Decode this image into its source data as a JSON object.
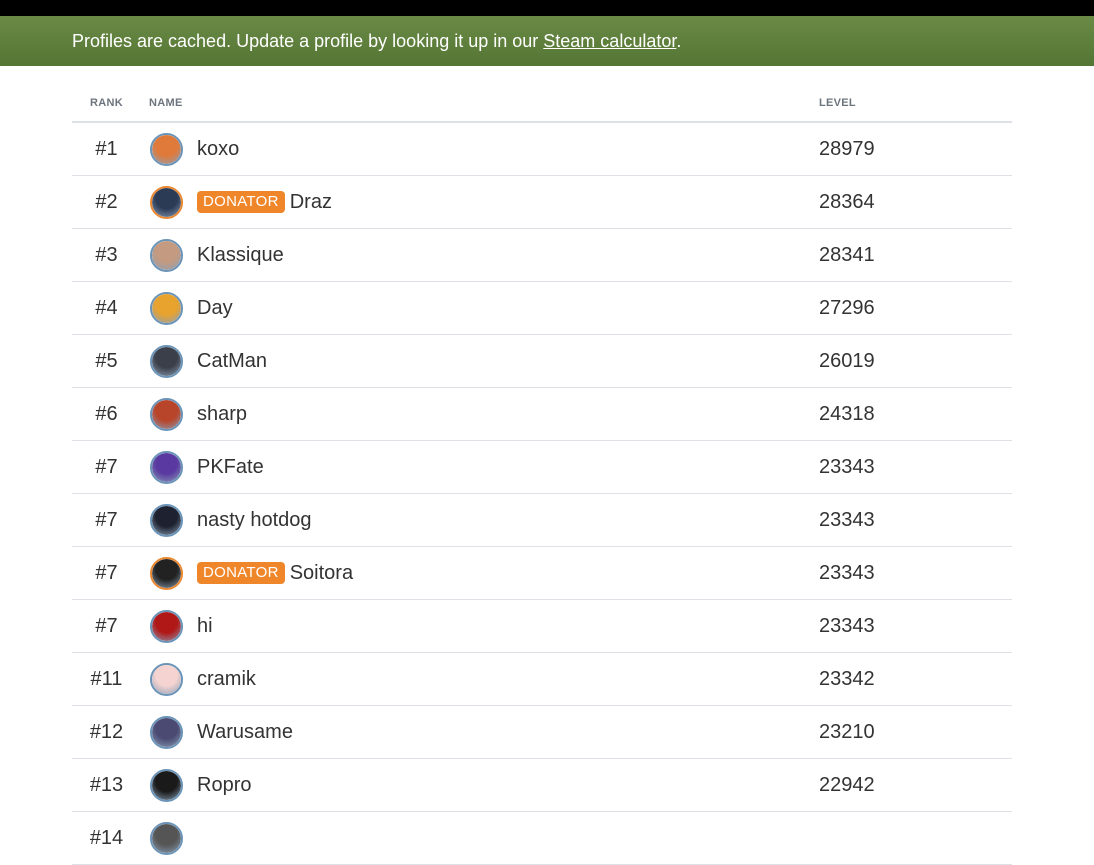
{
  "banner": {
    "text_before": "Profiles are cached. Update a profile by looking it up in our ",
    "link_label": "Steam calculator",
    "text_after": "."
  },
  "table": {
    "headers": {
      "rank": "RANK",
      "name": "NAME",
      "level": "LEVEL"
    },
    "rows": [
      {
        "rank": "#1",
        "name": "koxo",
        "level": "28979",
        "badge": "",
        "avatar_color": "#e07a3a"
      },
      {
        "rank": "#2",
        "name": "Draz",
        "level": "28364",
        "badge": "DONATOR",
        "avatar_color": "#2b3a55"
      },
      {
        "rank": "#3",
        "name": "Klassique",
        "level": "28341",
        "badge": "",
        "avatar_color": "#c49a80"
      },
      {
        "rank": "#4",
        "name": "Day",
        "level": "27296",
        "badge": "",
        "avatar_color": "#e8a32e"
      },
      {
        "rank": "#5",
        "name": "CatMan",
        "level": "26019",
        "badge": "",
        "avatar_color": "#3b3f4a"
      },
      {
        "rank": "#6",
        "name": "sharp",
        "level": "24318",
        "badge": "",
        "avatar_color": "#b8442a"
      },
      {
        "rank": "#7",
        "name": "PKFate",
        "level": "23343",
        "badge": "",
        "avatar_color": "#5a3aa0"
      },
      {
        "rank": "#7",
        "name": "nasty hotdog",
        "level": "23343",
        "badge": "",
        "avatar_color": "#1e2230"
      },
      {
        "rank": "#7",
        "name": "Soitora",
        "level": "23343",
        "badge": "DONATOR",
        "avatar_color": "#222222"
      },
      {
        "rank": "#7",
        "name": "hi",
        "level": "23343",
        "badge": "",
        "avatar_color": "#b01818"
      },
      {
        "rank": "#11",
        "name": "cramik",
        "level": "23342",
        "badge": "",
        "avatar_color": "#f5d3d0"
      },
      {
        "rank": "#12",
        "name": "Warusame",
        "level": "23210",
        "badge": "",
        "avatar_color": "#4a4a72"
      },
      {
        "rank": "#13",
        "name": "Ropro",
        "level": "22942",
        "badge": "",
        "avatar_color": "#1a1a1a"
      },
      {
        "rank": "#14",
        "name": "",
        "level": "",
        "badge": "",
        "avatar_color": "#555555"
      }
    ]
  }
}
